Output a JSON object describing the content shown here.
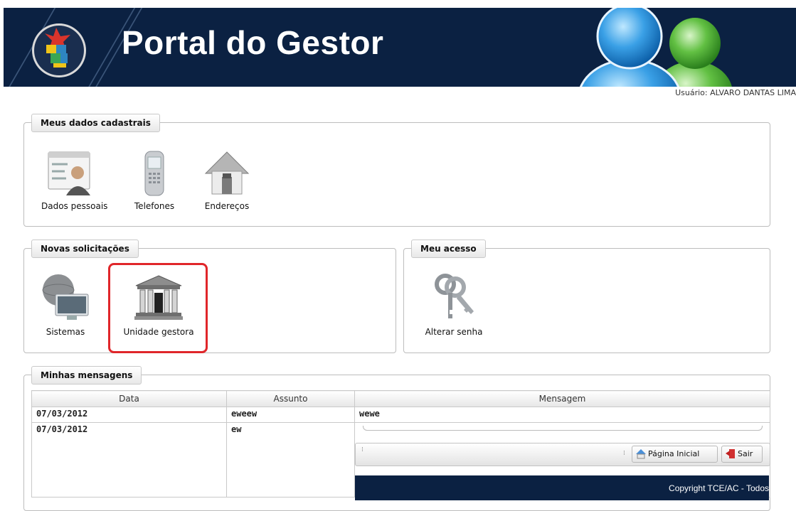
{
  "header": {
    "title": "Portal do Gestor",
    "user_label": "Usuário: ALVARO DANTAS LIMA"
  },
  "meus_dados": {
    "legend": "Meus dados cadastrais",
    "items": [
      {
        "label": "Dados pessoais",
        "icon": "id-card-person-icon"
      },
      {
        "label": "Telefones",
        "icon": "mobile-phone-icon"
      },
      {
        "label": "Endereços",
        "icon": "house-icon"
      }
    ]
  },
  "novas_solicitacoes": {
    "legend": "Novas solicitações",
    "items": [
      {
        "label": "Sistemas",
        "icon": "globe-monitor-icon"
      },
      {
        "label": "Unidade gestora",
        "icon": "government-building-icon"
      }
    ]
  },
  "meu_acesso": {
    "legend": "Meu acesso",
    "items": [
      {
        "label": "Alterar senha",
        "icon": "keys-icon"
      }
    ]
  },
  "mensagens": {
    "legend": "Minhas mensagens",
    "columns": [
      "Data",
      "Assunto",
      "Mensagem"
    ],
    "rows": [
      {
        "data": "07/03/2012",
        "assunto": "eweew",
        "mensagem": "wewe"
      },
      {
        "data": "07/03/2012",
        "assunto": "ew",
        "mensagem": ""
      }
    ]
  },
  "toolbar": {
    "home_label": "Página Inicial",
    "exit_label": "Sair"
  },
  "footer": {
    "copyright": "Copyright TCE/AC - Todos"
  },
  "colors": {
    "header_bg": "#0b2142",
    "highlight": "#e0262a"
  }
}
